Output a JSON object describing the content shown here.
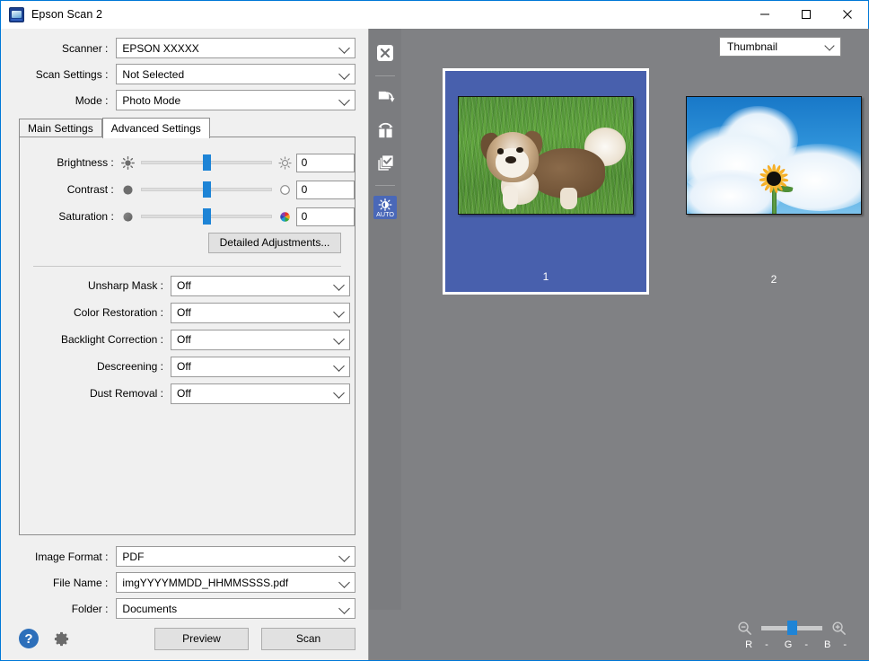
{
  "window": {
    "title": "Epson Scan 2",
    "icon": "scanner-icon",
    "controls": {
      "minimize": "—",
      "maximize": "□",
      "close": "✕"
    }
  },
  "top_fields": [
    {
      "label": "Scanner :",
      "value": "EPSON XXXXX",
      "name": "scanner"
    },
    {
      "label": "Scan Settings :",
      "value": "Not Selected",
      "name": "scan-settings"
    },
    {
      "label": "Mode :",
      "value": "Photo Mode",
      "name": "mode"
    }
  ],
  "tabs": [
    {
      "label": "Main Settings",
      "active": false
    },
    {
      "label": "Advanced Settings",
      "active": true
    }
  ],
  "sliders": [
    {
      "label": "Brightness :",
      "value": "0",
      "left_icon": "sun-filled-icon",
      "right_icon": "sun-outline-icon"
    },
    {
      "label": "Contrast :",
      "value": "0",
      "left_icon": "circle-filled-icon",
      "right_icon": "circle-outline-icon"
    },
    {
      "label": "Saturation :",
      "value": "0",
      "left_icon": "circle-grey-icon",
      "right_icon": "color-wheel-icon"
    }
  ],
  "detailed_adjustments_label": "Detailed Adjustments...",
  "dropdowns": [
    {
      "label": "Unsharp Mask :",
      "value": "Off",
      "name": "unsharp-mask"
    },
    {
      "label": "Color Restoration :",
      "value": "Off",
      "name": "color-restoration"
    },
    {
      "label": "Backlight Correction :",
      "value": "Off",
      "name": "backlight-correction"
    },
    {
      "label": "Descreening :",
      "value": "Off",
      "name": "descreening"
    },
    {
      "label": "Dust Removal :",
      "value": "Off",
      "name": "dust-removal"
    }
  ],
  "output_fields": [
    {
      "label": "Image Format :",
      "value": "PDF",
      "name": "image-format"
    },
    {
      "label": "File Name :",
      "value": "imgYYYYMMDD_HHMMSSSS.pdf",
      "name": "file-name"
    },
    {
      "label": "Folder :",
      "value": "Documents",
      "name": "folder"
    }
  ],
  "bottom_bar": {
    "help_icon": "help-icon",
    "settings_icon": "gear-icon",
    "preview_label": "Preview",
    "scan_label": "Scan"
  },
  "preview": {
    "view_mode": "Thumbnail",
    "toolbar": [
      {
        "name": "close-preview-icon",
        "active": false
      },
      {
        "name": "rotate-right-icon",
        "active": false
      },
      {
        "name": "mirror-flip-icon",
        "active": false
      },
      {
        "name": "select-all-pages-icon",
        "active": false
      },
      {
        "name": "auto-exposure-icon",
        "active": true,
        "label": "AUTO"
      }
    ],
    "thumbnails": [
      {
        "number": "1",
        "selected": true,
        "name": "thumbnail-dog"
      },
      {
        "number": "2",
        "selected": false,
        "name": "thumbnail-sunflower"
      }
    ],
    "zoom": {
      "zoom_out_icon": "zoom-out-icon",
      "zoom_in_icon": "zoom-in-icon"
    },
    "rgb_readout": [
      {
        "label": "R",
        "value": "-"
      },
      {
        "label": "G",
        "value": "-"
      },
      {
        "label": "B",
        "value": "-"
      }
    ]
  },
  "colors": {
    "accent": "#1e84d6",
    "thumbnail_selected": "#4860ad",
    "preview_background": "#808184",
    "window_border": "#0078d7"
  }
}
